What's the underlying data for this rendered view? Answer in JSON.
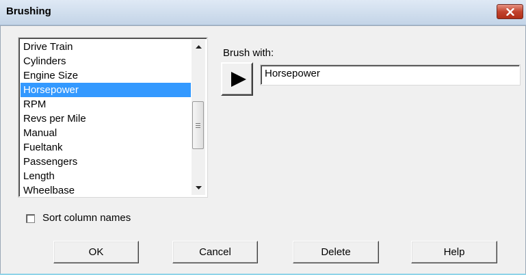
{
  "window": {
    "title": "Brushing"
  },
  "list": {
    "items": [
      "Drive Train",
      "Cylinders",
      "Engine Size",
      "Horsepower",
      "RPM",
      "Revs per Mile",
      "Manual",
      "Fueltank",
      "Passengers",
      "Length",
      "Wheelbase"
    ],
    "selected_index": 3
  },
  "brush": {
    "label": "Brush with:",
    "value": "Horsepower"
  },
  "sort": {
    "label": "Sort column names",
    "checked": false
  },
  "buttons": {
    "ok": "OK",
    "cancel": "Cancel",
    "delete": "Delete",
    "help": "Help"
  }
}
